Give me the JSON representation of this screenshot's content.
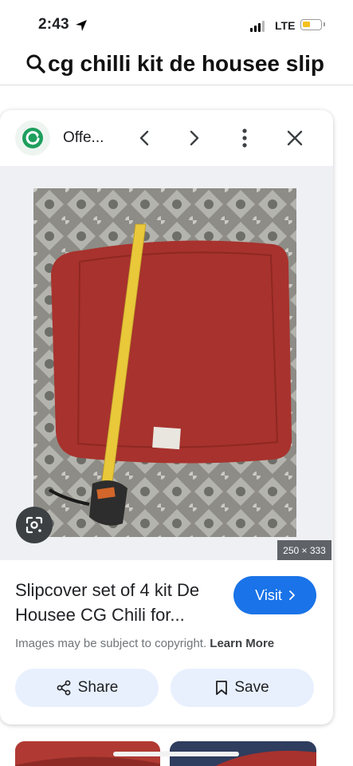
{
  "status_bar": {
    "time": "2:43",
    "network": "LTE",
    "battery_level": 0.3,
    "icons": [
      "location-arrow-icon",
      "signal-icon",
      "battery-icon"
    ]
  },
  "search": {
    "query": "cg chilli kit de housee slip",
    "icon": "search-icon"
  },
  "card": {
    "site_name": "Offe...",
    "header_icons": [
      "site-logo-icon",
      "chevron-left-icon",
      "chevron-right-icon",
      "more-vert-icon",
      "close-icon"
    ],
    "image_dimensions": "250 × 333",
    "image_alt": "Red slipcover cushion with yellow tape measure on patterned bedspread",
    "lens_icon": "google-lens-icon",
    "title": "Slipcover set of 4 kit De Housee CG Chili for...",
    "visit_label": "Visit",
    "copyright_text": "Images may be subject to copyright.",
    "learn_more_label": "Learn More",
    "share_label": "Share",
    "save_label": "Save"
  },
  "colors": {
    "accent": "#1a73e8",
    "button_bg": "#e8f0fe",
    "cushion": "#a8322d",
    "tape": "#e9c83a"
  }
}
